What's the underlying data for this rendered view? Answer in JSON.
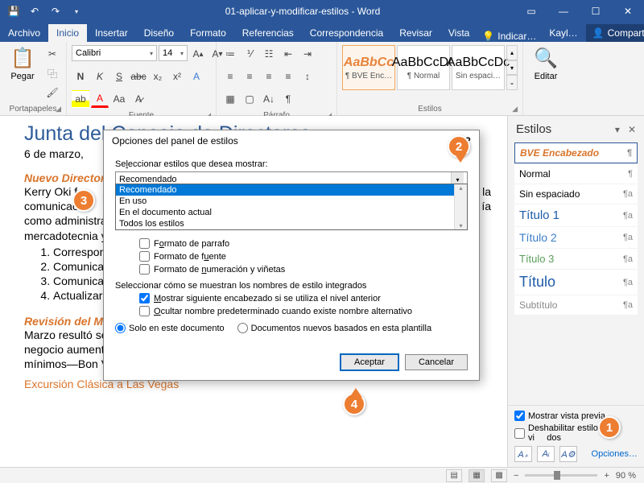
{
  "titlebar": {
    "title": "01-aplicar-y-modificar-estilos - Word"
  },
  "tabs": {
    "file": "Archivo",
    "home": "Inicio",
    "insert": "Insertar",
    "design": "Diseño",
    "layout": "Formato",
    "references": "Referencias",
    "mailings": "Correspondencia",
    "review": "Revisar",
    "view": "Vista",
    "tell": "Indicar…",
    "user": "Kayl…",
    "share": "Compartir"
  },
  "ribbon": {
    "clipboard": {
      "paste": "Pegar",
      "label": "Portapapeles"
    },
    "font": {
      "name": "Calibri",
      "size": "14",
      "label": "Fuente"
    },
    "paragraph": {
      "label": "Párrafo"
    },
    "styles": {
      "label": "Estilos",
      "items": [
        {
          "preview": "AaBbCc",
          "name": "¶ BVE Enc…"
        },
        {
          "preview": "AaBbCcDc",
          "name": "¶ Normal"
        },
        {
          "preview": "AaBbCcDc",
          "name": "Sin espaci…"
        }
      ]
    },
    "editing": {
      "label": "Editar"
    }
  },
  "doc": {
    "h1": "Junta del Consejo de Directores",
    "date": "6 de marzo,",
    "h2a": "Nuevo Director d",
    "p1a": "Kerry Oki f",
    "p1b": "a la",
    "p2a": "comunicac",
    "p2b": "ía",
    "p3": "como administra",
    "p4": "mercadotecnia y",
    "li1": "Correspon",
    "li2": "Comunicac",
    "li3": "Comunicac",
    "li4": "Actualizar",
    "h2b": "Revisión del Mes",
    "p5": "Marzo resultó se",
    "p6": "negocio aument",
    "p7": "mínimos—Bon Voyage sólo recibió una queja de un cliente por un retraso.",
    "h3": "Excursión Clásica a Las Vegas"
  },
  "pane": {
    "title": "Estilos",
    "items": {
      "bve": "BVE Encabezado",
      "normal": "Normal",
      "sin": "Sin espaciado",
      "t1": "Título 1",
      "t2": "Título 2",
      "t3": "Título 3",
      "titulo": "Título",
      "sub": "Subtítulo"
    },
    "preview": "Mostrar vista previa",
    "disable": "Deshabilitar estilos vi",
    "disable2": "dos",
    "options": "Opciones…"
  },
  "dialog": {
    "title": "Opciones del panel de estilos",
    "lblSelect": "Seleccionar estilos que desea mostrar:",
    "comboValue": "Recomendado",
    "opts": {
      "rec": "Recomendado",
      "uso": "En uso",
      "doc": "En el documento actual",
      "todos": "Todos los estilos"
    },
    "chkPar": "Formato de parrafo",
    "chkFnt": "Formato de fuente",
    "chkNum": "Formato de numeración y viñetas",
    "lblBuiltin": "Seleccionar cómo se muestran los nombres de estilo integrados",
    "chkNext": "Mostrar siguiente encabezado si se utiliza el nivel anterior",
    "chkHide": "Ocultar nombre predeterminado cuando existe nombre alternativo",
    "radioDoc": "Solo en este documento",
    "radioTpl": "Documentos nuevos basados en esta plantilla",
    "ok": "Aceptar",
    "cancel": "Cancelar"
  },
  "status": {
    "zoom": "90 %"
  },
  "callouts": {
    "c1": "1",
    "c2": "2",
    "c3": "3",
    "c4": "4"
  }
}
